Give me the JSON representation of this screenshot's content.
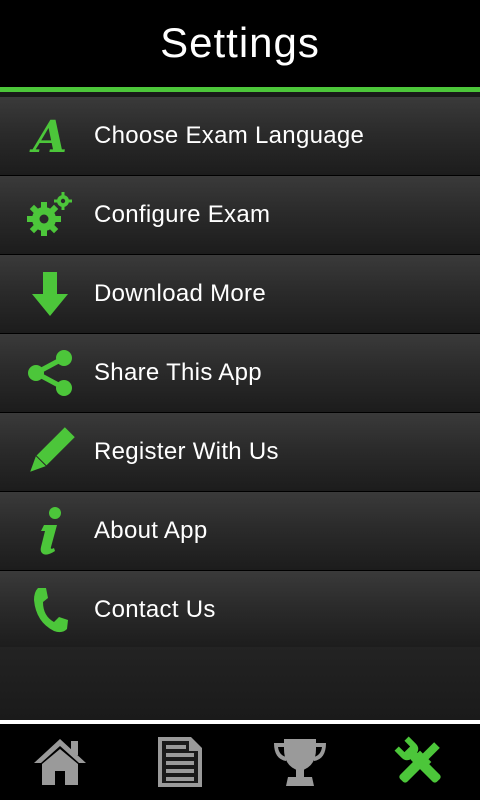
{
  "header": {
    "title": "Settings"
  },
  "menu": {
    "items": [
      {
        "label": "Choose Exam Language",
        "icon": "font-a-icon"
      },
      {
        "label": "Configure Exam",
        "icon": "gears-icon"
      },
      {
        "label": "Download More",
        "icon": "download-arrow-icon"
      },
      {
        "label": "Share This App",
        "icon": "share-icon"
      },
      {
        "label": "Register With Us",
        "icon": "pencil-icon"
      },
      {
        "label": "About App",
        "icon": "info-icon"
      },
      {
        "label": "Contact Us",
        "icon": "phone-icon"
      }
    ]
  },
  "tabbar": {
    "tabs": [
      {
        "icon": "home-icon",
        "active": false
      },
      {
        "icon": "document-icon",
        "active": false
      },
      {
        "icon": "trophy-icon",
        "active": false
      },
      {
        "icon": "tools-icon",
        "active": true
      }
    ]
  },
  "colors": {
    "accent": "#4cc63a",
    "inactive_icon": "#9a9a9a",
    "text": "#ffffff",
    "header_bg": "#000000"
  }
}
